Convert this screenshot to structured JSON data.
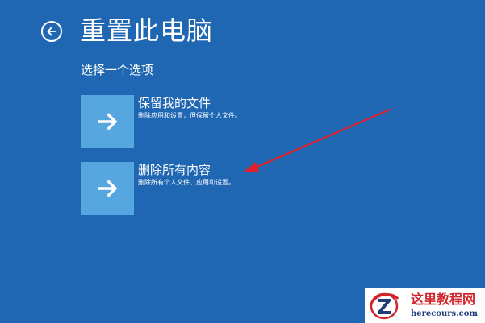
{
  "page": {
    "title": "重置此电脑",
    "subtitle": "选择一个选项"
  },
  "icons": {
    "back": "back-arrow-circle-icon",
    "option_arrow": "arrow-right-icon",
    "watermark_logo": "z-logo-icon"
  },
  "options": [
    {
      "title": "保留我的文件",
      "description": "删除应用和设置，但保留个人文件。"
    },
    {
      "title": "删除所有内容",
      "description": "删除所有个人文件、应用和设置。"
    }
  ],
  "watermark": {
    "name": "这里教程网",
    "domain": "herecours.com"
  },
  "colors": {
    "background": "#2067b3",
    "tile": "#56a6e0",
    "annotation_arrow": "#e0202a",
    "watermark_text": "#d0262b",
    "watermark_domain": "#1f3d7a"
  }
}
